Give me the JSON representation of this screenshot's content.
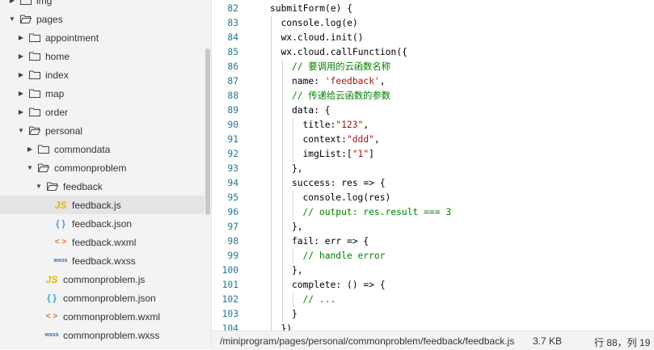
{
  "sidebar": {
    "items": [
      {
        "label": "img",
        "type": "folder",
        "expanded": false,
        "depth": 0
      },
      {
        "label": "pages",
        "type": "folder",
        "expanded": true,
        "depth": 0
      },
      {
        "label": "appointment",
        "type": "folder",
        "expanded": false,
        "depth": 1
      },
      {
        "label": "home",
        "type": "folder",
        "expanded": false,
        "depth": 1
      },
      {
        "label": "index",
        "type": "folder",
        "expanded": false,
        "depth": 1
      },
      {
        "label": "map",
        "type": "folder",
        "expanded": false,
        "depth": 1
      },
      {
        "label": "order",
        "type": "folder",
        "expanded": false,
        "depth": 1
      },
      {
        "label": "personal",
        "type": "folder",
        "expanded": true,
        "depth": 1
      },
      {
        "label": "commondata",
        "type": "folder",
        "expanded": false,
        "depth": 2
      },
      {
        "label": "commonproblem",
        "type": "folder",
        "expanded": true,
        "depth": 2
      },
      {
        "label": "feedback",
        "type": "folder",
        "expanded": true,
        "depth": 3
      },
      {
        "label": "feedback.js",
        "type": "js",
        "depth": 4,
        "selected": true
      },
      {
        "label": "feedback.json",
        "type": "json",
        "depth": 4
      },
      {
        "label": "feedback.wxml",
        "type": "wxml",
        "depth": 4
      },
      {
        "label": "feedback.wxss",
        "type": "wxss",
        "depth": 4
      },
      {
        "label": "commonproblem.js",
        "type": "js",
        "depth": 3
      },
      {
        "label": "commonproblem.json",
        "type": "json",
        "depth": 3
      },
      {
        "label": "commonproblem.wxml",
        "type": "wxml",
        "depth": 3
      },
      {
        "label": "commonproblem.wxss",
        "type": "wxss",
        "depth": 3
      }
    ],
    "icons": {
      "js": "JS",
      "json": "{ }",
      "wxml": "< >",
      "wxss": "wxss"
    }
  },
  "editor": {
    "lines": [
      {
        "num": "82",
        "indent": 0,
        "parts": [
          {
            "t": "submitForm(e) {"
          }
        ]
      },
      {
        "num": "83",
        "indent": 1,
        "parts": [
          {
            "t": "console.log(e)"
          }
        ]
      },
      {
        "num": "84",
        "indent": 1,
        "parts": [
          {
            "t": "wx.cloud.init()"
          }
        ]
      },
      {
        "num": "85",
        "indent": 1,
        "parts": [
          {
            "t": "wx.cloud.callFunction({"
          }
        ]
      },
      {
        "num": "86",
        "indent": 2,
        "parts": [
          {
            "t": "// 要调用的云函数名称",
            "c": "cmt"
          }
        ]
      },
      {
        "num": "87",
        "indent": 2,
        "parts": [
          {
            "t": "name: "
          },
          {
            "t": "'feedback'",
            "c": "str"
          },
          {
            "t": ","
          }
        ]
      },
      {
        "num": "88",
        "indent": 2,
        "parts": [
          {
            "t": "// 传递给云函数的参数",
            "c": "cmt"
          }
        ]
      },
      {
        "num": "89",
        "indent": 2,
        "parts": [
          {
            "t": "data: {"
          }
        ]
      },
      {
        "num": "90",
        "indent": 3,
        "parts": [
          {
            "t": "title:"
          },
          {
            "t": "\"123\"",
            "c": "str"
          },
          {
            "t": ","
          }
        ]
      },
      {
        "num": "91",
        "indent": 3,
        "parts": [
          {
            "t": "context:"
          },
          {
            "t": "\"ddd\"",
            "c": "str"
          },
          {
            "t": ","
          }
        ]
      },
      {
        "num": "92",
        "indent": 3,
        "parts": [
          {
            "t": "imgList:["
          },
          {
            "t": "\"1\"",
            "c": "str"
          },
          {
            "t": "]"
          }
        ]
      },
      {
        "num": "93",
        "indent": 2,
        "parts": [
          {
            "t": "},"
          }
        ]
      },
      {
        "num": "94",
        "indent": 2,
        "parts": [
          {
            "t": "success: res => {"
          }
        ]
      },
      {
        "num": "95",
        "indent": 3,
        "parts": [
          {
            "t": "console.log(res)"
          }
        ]
      },
      {
        "num": "96",
        "indent": 3,
        "parts": [
          {
            "t": "// output: res.result === 3",
            "c": "cmt"
          }
        ]
      },
      {
        "num": "97",
        "indent": 2,
        "parts": [
          {
            "t": "},"
          }
        ]
      },
      {
        "num": "98",
        "indent": 2,
        "parts": [
          {
            "t": "fail: err => {"
          }
        ]
      },
      {
        "num": "99",
        "indent": 3,
        "parts": [
          {
            "t": "// handle error",
            "c": "cmt"
          }
        ]
      },
      {
        "num": "100",
        "indent": 2,
        "parts": [
          {
            "t": "},"
          }
        ]
      },
      {
        "num": "101",
        "indent": 2,
        "parts": [
          {
            "t": "complete: () => {"
          }
        ]
      },
      {
        "num": "102",
        "indent": 3,
        "parts": [
          {
            "t": "// ...",
            "c": "cmt"
          }
        ]
      },
      {
        "num": "103",
        "indent": 2,
        "parts": [
          {
            "t": "}"
          }
        ]
      },
      {
        "num": "104",
        "indent": 1,
        "parts": [
          {
            "t": "})"
          }
        ]
      }
    ]
  },
  "statusbar": {
    "path": "/miniprogram/pages/personal/commonproblem/feedback/feedback.js",
    "size": "3.7 KB",
    "position": "行 88，列 19"
  },
  "colors": {
    "line_number": "#237893",
    "string": "#a31515",
    "comment": "#008000",
    "selected_row": "#e4e4e4"
  }
}
